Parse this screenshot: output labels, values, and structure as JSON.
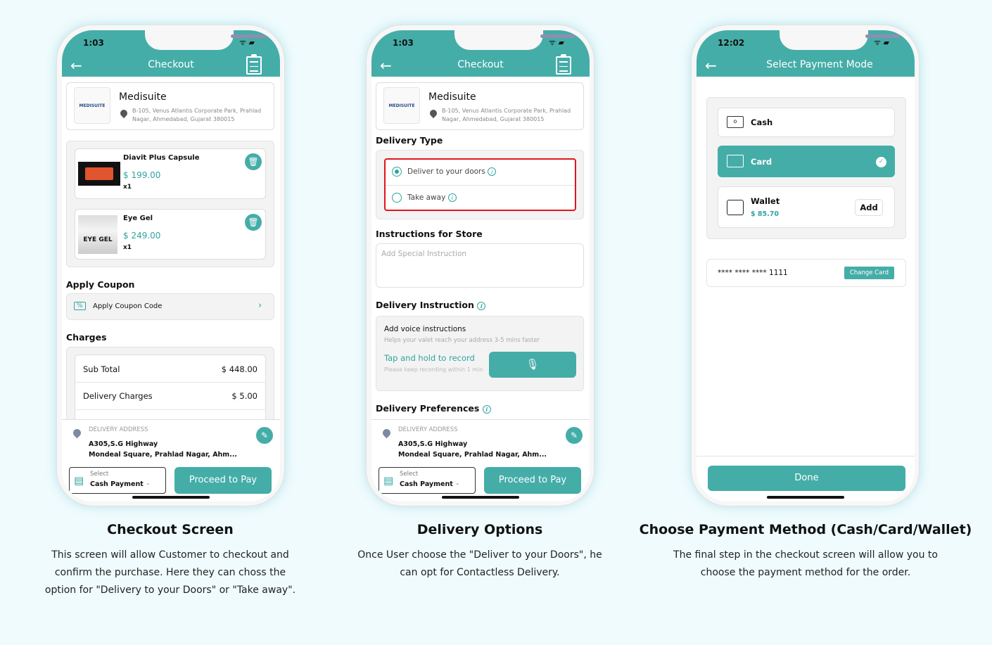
{
  "colors": {
    "accent": "#45ada8",
    "background": "#effbfd",
    "highlight": "#e0141e"
  },
  "checkout": {
    "time": "1:03",
    "title": "Checkout",
    "store": {
      "name": "Medisuite",
      "logo": "MEDISUITE",
      "address": "B-105, Venus Atlantis Corporate Park, Prahlad Nagar, Ahmedabad, Gujarat 380015"
    },
    "items": [
      {
        "name": "Diavit Plus Capsule",
        "price": "$ 199.00",
        "qty": "x1"
      },
      {
        "name": "Eye Gel",
        "price": "$ 249.00",
        "qty": "x1",
        "image_text": "EYE GEL"
      }
    ],
    "coupon_heading": "Apply Coupon",
    "coupon_label": "Apply Coupon Code",
    "charges_heading": "Charges",
    "charges": [
      {
        "label": "Sub Total",
        "value": "$ 448.00"
      },
      {
        "label": "Delivery Charges",
        "value": "$ 5.00"
      }
    ]
  },
  "bottom": {
    "addr_label": "DELIVERY ADDRESS",
    "line1": "A305,S.G Highway",
    "line2": "Mondeal Square, Prahlad Nagar, Ahm...",
    "select_small": "Select",
    "select_value": "Cash Payment",
    "proceed": "Proceed to Pay"
  },
  "delivery": {
    "time": "1:03",
    "title": "Checkout",
    "type_heading": "Delivery Type",
    "options": [
      {
        "label": "Deliver to your doors",
        "selected": true
      },
      {
        "label": "Take away",
        "selected": false
      }
    ],
    "store_heading": "Instructions for Store",
    "store_placeholder": "Add Special Instruction",
    "instr_heading": "Delivery Instruction",
    "voice_title": "Add voice instructions",
    "voice_sub": "Helps your valet reach your address 3-5 mins faster",
    "record": "Tap and hold to record",
    "record_sub": "Please keep recording within 1 min",
    "pref_heading": "Delivery Preferences"
  },
  "payment": {
    "time": "12:02",
    "title": "Select Payment Mode",
    "cash": "Cash",
    "card": "Card",
    "wallet": "Wallet",
    "wallet_balance": "$ 85.70",
    "add": "Add",
    "card_number": "**** **** **** 1111",
    "change_card": "Change Card",
    "done": "Done"
  },
  "captions": [
    {
      "title": "Checkout Screen",
      "body": "This screen will allow Customer to checkout and confirm the purchase. Here they can choss the option for \"Delivery to your Doors\" or \"Take away\"."
    },
    {
      "title": "Delivery Options",
      "body": "Once User choose the \"Deliver to your Doors\", he can opt for Contactless Delivery."
    },
    {
      "title": "Choose Payment Method (Cash/Card/Wallet)",
      "body": "The final step in the checkout screen will allow you to choose the payment method for the order."
    }
  ]
}
